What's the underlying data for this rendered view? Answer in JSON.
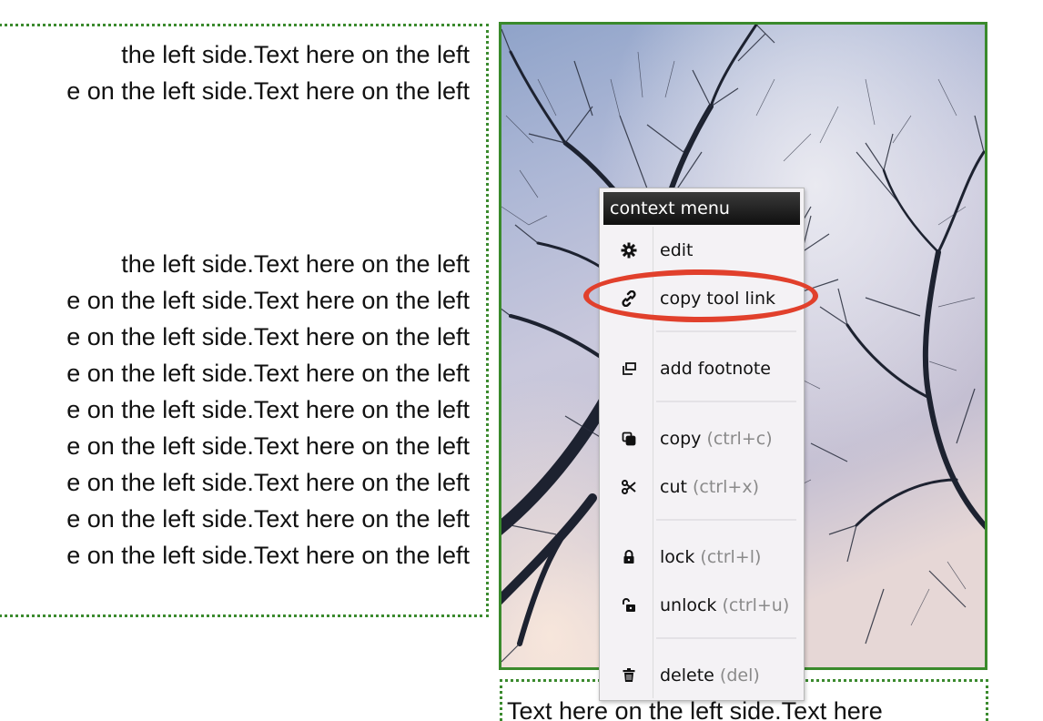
{
  "left_block": {
    "lines_top": [
      "the left side.Text here on the left",
      "e on the left side.Text here on the left"
    ],
    "lines_bottom": [
      "the left side.Text here on the left",
      "e on the left side.Text here on the left",
      "e on the left side.Text here on the left",
      "e on the left side.Text here on the left",
      "e on the left side.Text here on the left",
      "e on the left side.Text here on the left",
      "e on the left side.Text here on the left",
      "e on the left side.Text here on the left",
      "e on the left side.Text here on the left"
    ]
  },
  "bottom_block": {
    "text": "Text here on the left side.Text here"
  },
  "context_menu": {
    "title": "context menu",
    "items": [
      {
        "icon": "gear-icon",
        "label": "edit",
        "shortcut": ""
      },
      {
        "icon": "link-icon",
        "label": "copy tool link",
        "shortcut": ""
      },
      {
        "icon": "footnote-icon",
        "label": "add footnote",
        "shortcut": ""
      },
      {
        "icon": "copy-icon",
        "label": "copy",
        "shortcut": "(ctrl+c)"
      },
      {
        "icon": "scissors-icon",
        "label": "cut",
        "shortcut": "(ctrl+x)"
      },
      {
        "icon": "lock-icon",
        "label": "lock",
        "shortcut": "(ctrl+l)"
      },
      {
        "icon": "unlock-icon",
        "label": "unlock",
        "shortcut": "(ctrl+u)"
      },
      {
        "icon": "trash-icon",
        "label": "delete",
        "shortcut": "(del)"
      }
    ]
  },
  "colors": {
    "frame_border": "#3a8a2c",
    "highlight": "#e1402c",
    "menu_header": "#1a1a1a"
  }
}
